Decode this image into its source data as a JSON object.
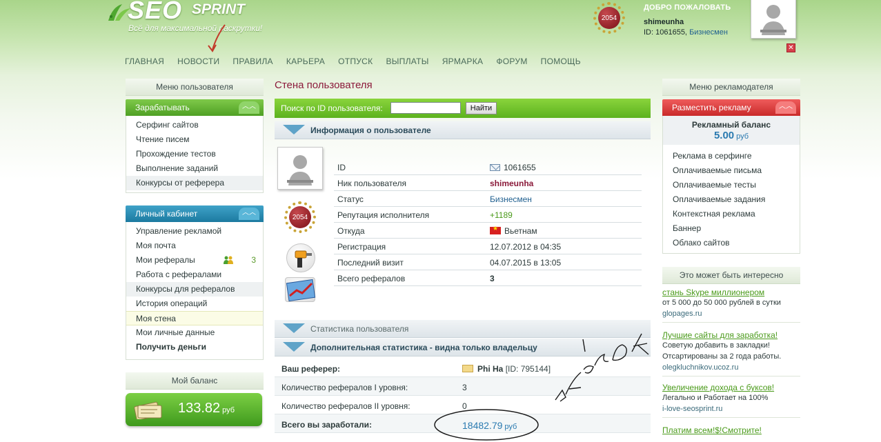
{
  "header": {
    "logo_main": "SEO",
    "logo_sub": "SPRINT",
    "tagline": "Всё для максимальной раскрутки!",
    "medal_value": "2054",
    "welcome": "ДОБРО ПОЖАЛОВАТЬ",
    "username": "shimeunha",
    "id_text": "ID: 1061655,",
    "status": "Бизнесмен",
    "logout_symbol": "✕"
  },
  "nav": [
    "ГЛАВНАЯ",
    "НОВОСТИ",
    "ПРАВИЛА",
    "КАРЬЕРА",
    "ОТПУСК",
    "ВЫПЛАТЫ",
    "ЯРМАРКА",
    "ФОРУМ",
    "ПОМОЩЬ"
  ],
  "left": {
    "menu_title": "Меню пользователя",
    "earn_title": "Зарабатывать",
    "earn_items": [
      "Серфинг сайтов",
      "Чтение писем",
      "Прохождение тестов",
      "Выполнение заданий",
      "Конкурсы от реферера"
    ],
    "cabinet_title": "Личный кабинет",
    "cabinet_items": [
      "Управление рекламой",
      "Моя почта",
      "Мои рефералы",
      "Работа с рефералами",
      "Конкурсы для рефералов",
      "История операций",
      "Моя стена",
      "Мои личные данные",
      "Получить деньги"
    ],
    "referrals_count": "3",
    "balance_title": "Мой баланс",
    "balance_value": "133.82",
    "balance_unit": "руб"
  },
  "right": {
    "menu_title": "Меню рекламодателя",
    "place_ad": "Разместить рекламу",
    "ad_balance_title": "Рекламный баланс",
    "ad_balance_value": "5.00",
    "ad_balance_unit": "руб",
    "ad_items": [
      "Реклама в серфинге",
      "Оплачиваемые письма",
      "Оплачиваемые тесты",
      "Оплачиваемые задания",
      "Контекстная реклама",
      "Баннер",
      "Облако сайтов"
    ],
    "interesting_title": "Это может быть интересно",
    "ads": [
      {
        "title": "стань Skype миллионером",
        "text": "от 5 000 до 50 000 рублей в сутки",
        "url": "glopages.ru"
      },
      {
        "title": "Лучшие сайты для заработка!",
        "text": "Советую добавить в закладки! Отсартированы за 2 года работы.",
        "url": "olegkluchnikov.ucoz.ru"
      },
      {
        "title": "Увеличение дохода с буксов!",
        "text": "Легально и Работает на 100%",
        "url": "i-love-seosprint.ru"
      },
      {
        "title": "Платим всем!$!Смотрите!",
        "text": "",
        "url": ""
      }
    ]
  },
  "main": {
    "wall_title": "Стена пользователя",
    "search_label": "Поиск по ID пользователя:",
    "search_value": "",
    "search_button": "Найти",
    "info_title": "Информация о пользователе",
    "profile_medal": "2054",
    "info_rows": [
      {
        "k": "ID",
        "v": "1061655"
      },
      {
        "k": "Ник пользователя",
        "v": "shimeunha"
      },
      {
        "k": "Статус",
        "v": "Бизнесмен"
      },
      {
        "k": "Репутация исполнителя",
        "v": "+1189"
      },
      {
        "k": "Откуда",
        "v": "Вьетнам"
      },
      {
        "k": "Регистрация",
        "v": "12.07.2012 в 04:35"
      },
      {
        "k": "Последний визит",
        "v": "04.07.2015 в 13:05"
      },
      {
        "k": "Всего рефералов",
        "v": "3"
      }
    ],
    "stats_title": "Статистика пользователя",
    "extra_title": "Дополнительная статистика - видна только владельцу",
    "extra_rows": [
      {
        "k": "Ваш реферер:",
        "name": "Phi Ha",
        "id": "[ID: 795144]"
      },
      {
        "k": "Количество рефералов I уровня:",
        "v": "3"
      },
      {
        "k": "Количество рефералов II уровня:",
        "v": "0"
      },
      {
        "k": "Всего вы заработали:",
        "v": "18482.79",
        "unit": "руб"
      }
    ]
  }
}
